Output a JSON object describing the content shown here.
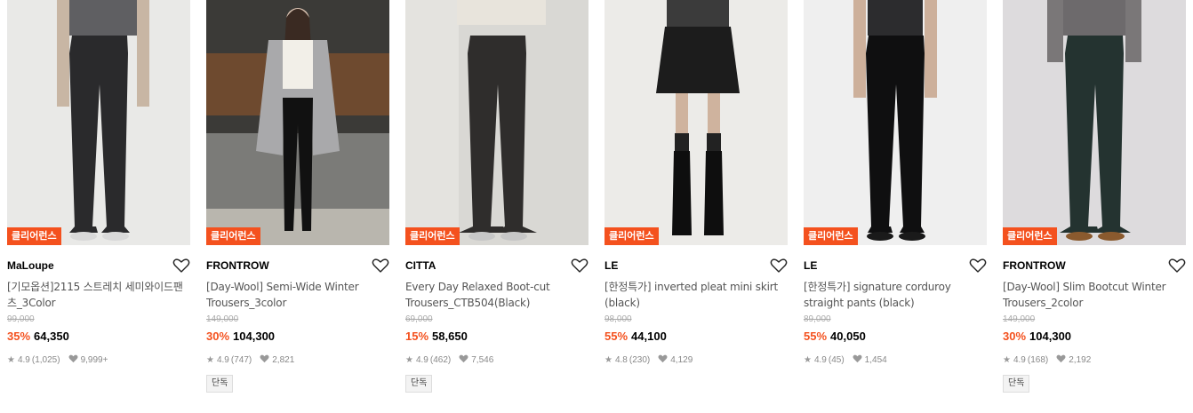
{
  "badge_label": "클리어런스",
  "products": [
    {
      "brand": "MaLoupe",
      "name": "[기모옵션]2115 스트레치 세미와이드팬츠_3Color",
      "original_price": "99,000",
      "discount": "35%",
      "price": "64,350",
      "rating": "4.9",
      "reviews": "(1,025)",
      "likes": "9,999+",
      "tag": "",
      "image": "black-wide-pants-model-icon"
    },
    {
      "brand": "FRONTROW",
      "name": "[Day-Wool] Semi-Wide Winter Trousers_3color",
      "original_price": "149,000",
      "discount": "30%",
      "price": "104,300",
      "rating": "4.9",
      "reviews": "(747)",
      "likes": "2,821",
      "tag": "단독",
      "image": "street-model-grey-coat-icon"
    },
    {
      "brand": "CITTA",
      "name": "Every Day Relaxed Boot-cut Trousers_CTB504(Black)",
      "original_price": "69,000",
      "discount": "15%",
      "price": "58,650",
      "rating": "4.9",
      "reviews": "(462)",
      "likes": "7,546",
      "tag": "단독",
      "image": "bootcut-trousers-model-icon"
    },
    {
      "brand": "LE",
      "name": "[한정특가] inverted pleat mini skirt (black)",
      "original_price": "98,000",
      "discount": "55%",
      "price": "44,100",
      "rating": "4.8",
      "reviews": "(230)",
      "likes": "4,129",
      "tag": "",
      "image": "mini-skirt-model-icon"
    },
    {
      "brand": "LE",
      "name": "[한정특가] signature corduroy straight pants (black)",
      "original_price": "89,000",
      "discount": "55%",
      "price": "40,050",
      "rating": "4.9",
      "reviews": "(45)",
      "likes": "1,454",
      "tag": "",
      "image": "corduroy-pants-model-icon"
    },
    {
      "brand": "FRONTROW",
      "name": "[Day-Wool] Slim Bootcut Winter Trousers_2color",
      "original_price": "149,000",
      "discount": "30%",
      "price": "104,300",
      "rating": "4.9",
      "reviews": "(168)",
      "likes": "2,192",
      "tag": "단독",
      "image": "green-bootcut-model-icon"
    }
  ],
  "colors": {
    "accent": "#f4511e",
    "muted": "#888888"
  }
}
